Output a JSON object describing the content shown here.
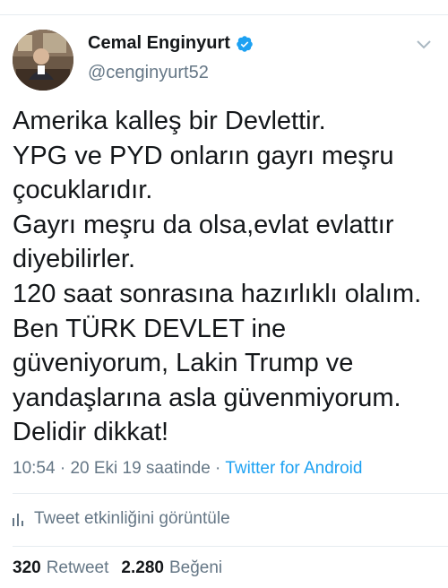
{
  "author": {
    "display_name": "Cemal Enginyurt",
    "handle": "@cenginyurt52"
  },
  "tweet": {
    "text": "Amerika kalleş bir Devlettir.\nYPG ve PYD onların gayrı meşru çocuklarıdır.\nGayrı meşru da olsa,evlat evlattır diyebilirler.\n120 saat sonrasına hazırlıklı olalım. Ben TÜRK DEVLET ine güveniyorum, Lakin Trump ve yandaşlarına asla güvenmiyorum. Delidir dikkat!",
    "time": "10:54",
    "date": "20 Eki 19 saatinde",
    "source": "Twitter for Android",
    "separator": " · "
  },
  "activity": {
    "label": "Tweet etkinliğini görüntüle"
  },
  "counts": {
    "retweets": "320",
    "retweets_label": "Retweet",
    "likes": "2.280",
    "likes_label": "Beğeni"
  },
  "icons": {
    "verified": "verified-badge-icon",
    "caret": "chevron-down-icon",
    "stats": "bar-chart-icon"
  },
  "colors": {
    "link": "#1da1f2",
    "secondary_text": "#657786",
    "primary_text": "#14171a",
    "divider": "#e6ecf0"
  }
}
